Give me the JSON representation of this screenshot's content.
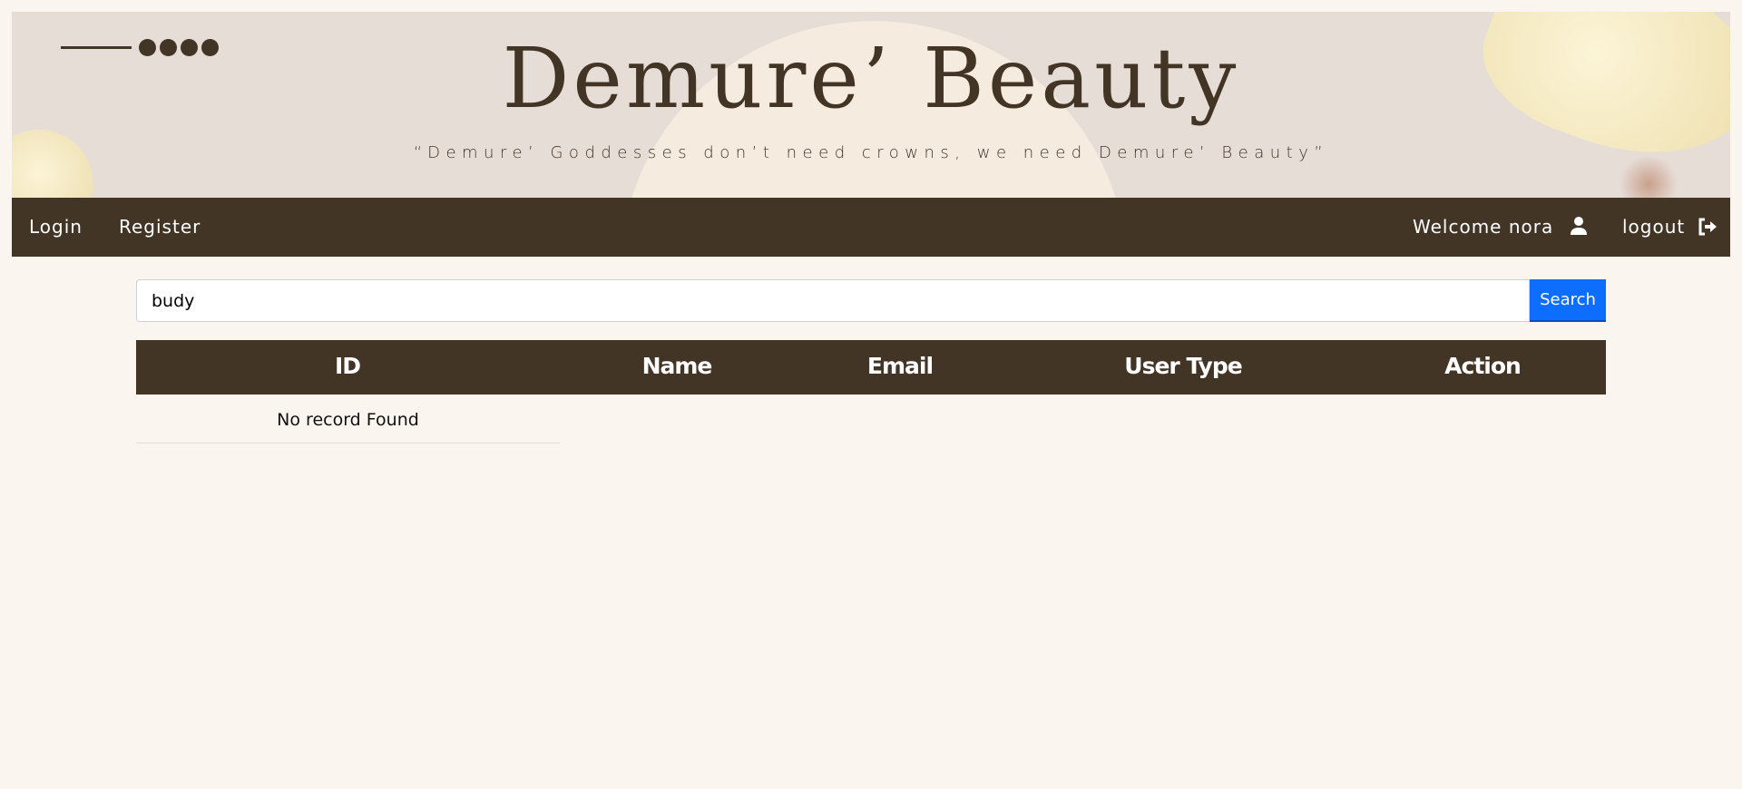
{
  "banner": {
    "title": "Demure’ Beauty",
    "tagline": "“Demure’ Goddesses don’t need crowns, we need Demure’ Beauty”"
  },
  "nav": {
    "login": "Login",
    "register": "Register",
    "welcome": "Welcome nora",
    "logout": "logout"
  },
  "search": {
    "value": "budy",
    "button": "Search"
  },
  "table": {
    "headers": [
      "ID",
      "Name",
      "Email",
      "User Type",
      "Action"
    ],
    "empty_message": "No record Found"
  },
  "colors": {
    "brand": "#433526",
    "accent": "#0d6efd",
    "background": "#faf6ef"
  }
}
